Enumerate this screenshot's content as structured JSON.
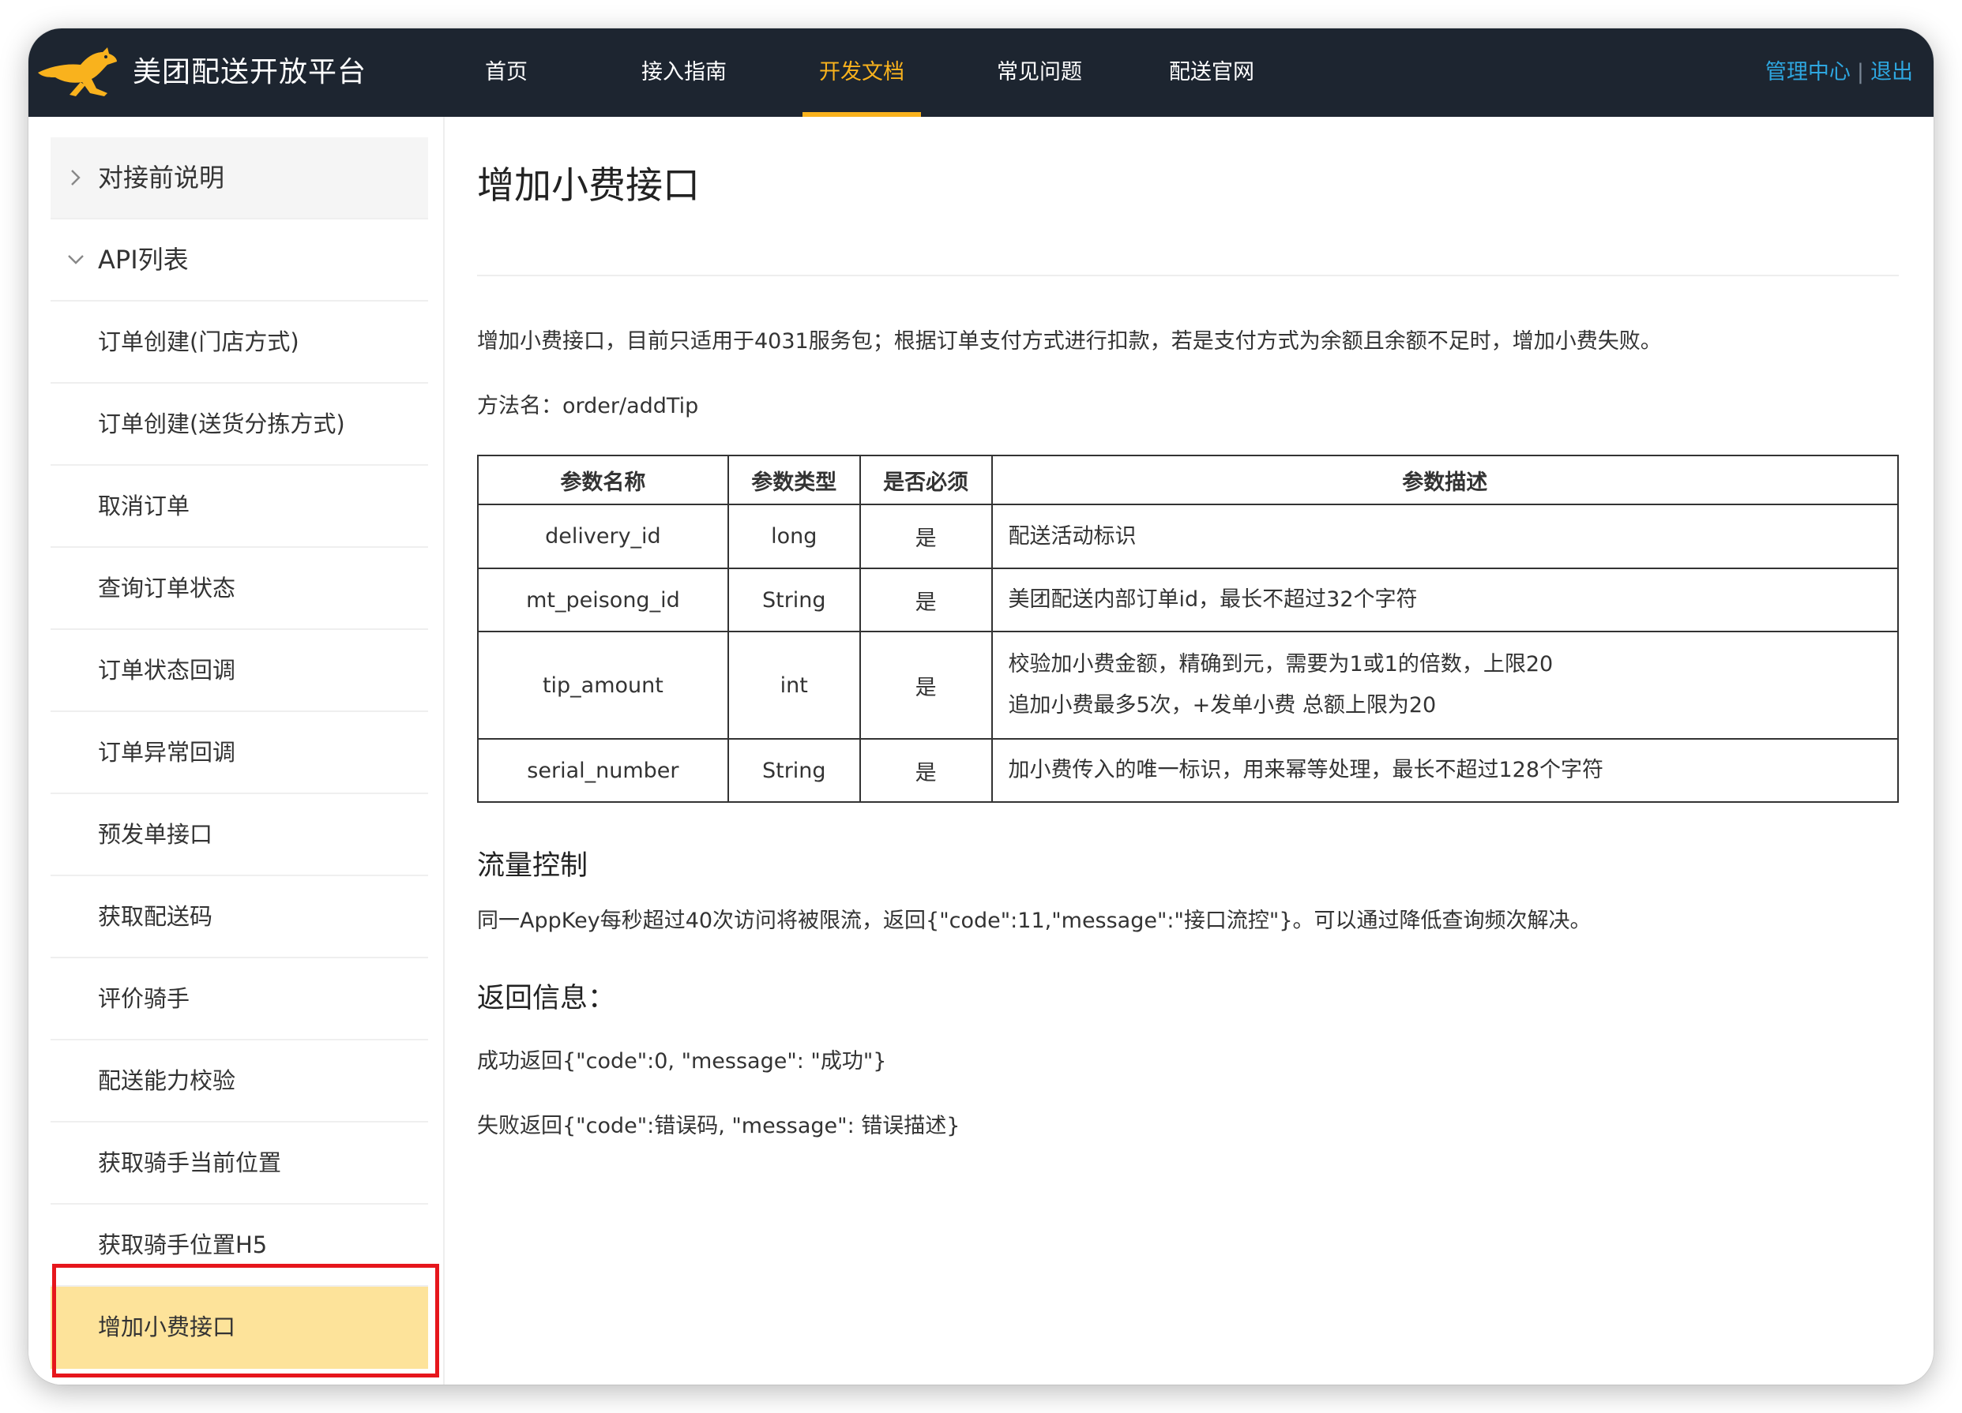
{
  "header": {
    "brand": "美团配送开放平台",
    "nav": [
      {
        "label": "首页",
        "active": false
      },
      {
        "label": "接入指南",
        "active": false
      },
      {
        "label": "开发文档",
        "active": true
      },
      {
        "label": "常见问题",
        "active": false
      },
      {
        "label": "配送官网",
        "active": false
      }
    ],
    "admin_link": "管理中心",
    "separator": "|",
    "logout_link": "退出"
  },
  "sidebar": {
    "items": [
      {
        "label": "对接前说明",
        "type": "group",
        "expanded": false
      },
      {
        "label": "API列表",
        "type": "group",
        "expanded": true
      },
      {
        "label": "订单创建(门店方式)"
      },
      {
        "label": "订单创建(送货分拣方式)"
      },
      {
        "label": "取消订单"
      },
      {
        "label": "查询订单状态"
      },
      {
        "label": "订单状态回调"
      },
      {
        "label": "订单异常回调"
      },
      {
        "label": "预发单接口"
      },
      {
        "label": "获取配送码"
      },
      {
        "label": "评价骑手"
      },
      {
        "label": "配送能力校验"
      },
      {
        "label": "获取骑手当前位置"
      },
      {
        "label": "获取骑手位置H5"
      },
      {
        "label": "增加小费接口",
        "selected": true
      }
    ]
  },
  "content": {
    "title": "增加小费接口",
    "intro": "增加小费接口，目前只适用于4031服务包；根据订单支付方式进行扣款，若是支付方式为余额且余额不足时，增加小费失败。",
    "method": "方法名：order/addTip",
    "table": {
      "headers": [
        "参数名称",
        "参数类型",
        "是否必须",
        "参数描述"
      ],
      "rows": [
        {
          "name": "delivery_id",
          "type": "long",
          "required": "是",
          "desc": [
            "配送活动标识"
          ]
        },
        {
          "name": "mt_peisong_id",
          "type": "String",
          "required": "是",
          "desc": [
            "美团配送内部订单id，最长不超过32个字符"
          ]
        },
        {
          "name": "tip_amount",
          "type": "int",
          "required": "是",
          "desc": [
            "校验加小费金额，精确到元，需要为1或1的倍数，上限20",
            "追加小费最多5次，+发单小费 总额上限为20"
          ]
        },
        {
          "name": "serial_number",
          "type": "String",
          "required": "是",
          "desc": [
            "加小费传入的唯一标识，用来幂等处理，最长不超过128个字符"
          ]
        }
      ]
    },
    "flow_title": "流量控制",
    "flow_text": "同一AppKey每秒超过40次访问将被限流，返回{\"code\":11,\"message\":\"接口流控\"}。可以通过降低查询频次解决。",
    "return_title": "返回信息：",
    "success_text": "成功返回{\"code\":0, \"message\": \"成功\"}",
    "fail_text": "失败返回{\"code\":错误码, \"message\": 错误描述}"
  },
  "colors": {
    "header_bg": "#1d2530",
    "accent": "#f9b21d",
    "link": "#2ea7e0",
    "selected_bg": "#fde39a",
    "highlight_border": "#e6161c"
  },
  "icons": {
    "logo": "kangaroo-logo",
    "collapsed": "chevron-right-icon",
    "expanded": "chevron-down-icon"
  }
}
